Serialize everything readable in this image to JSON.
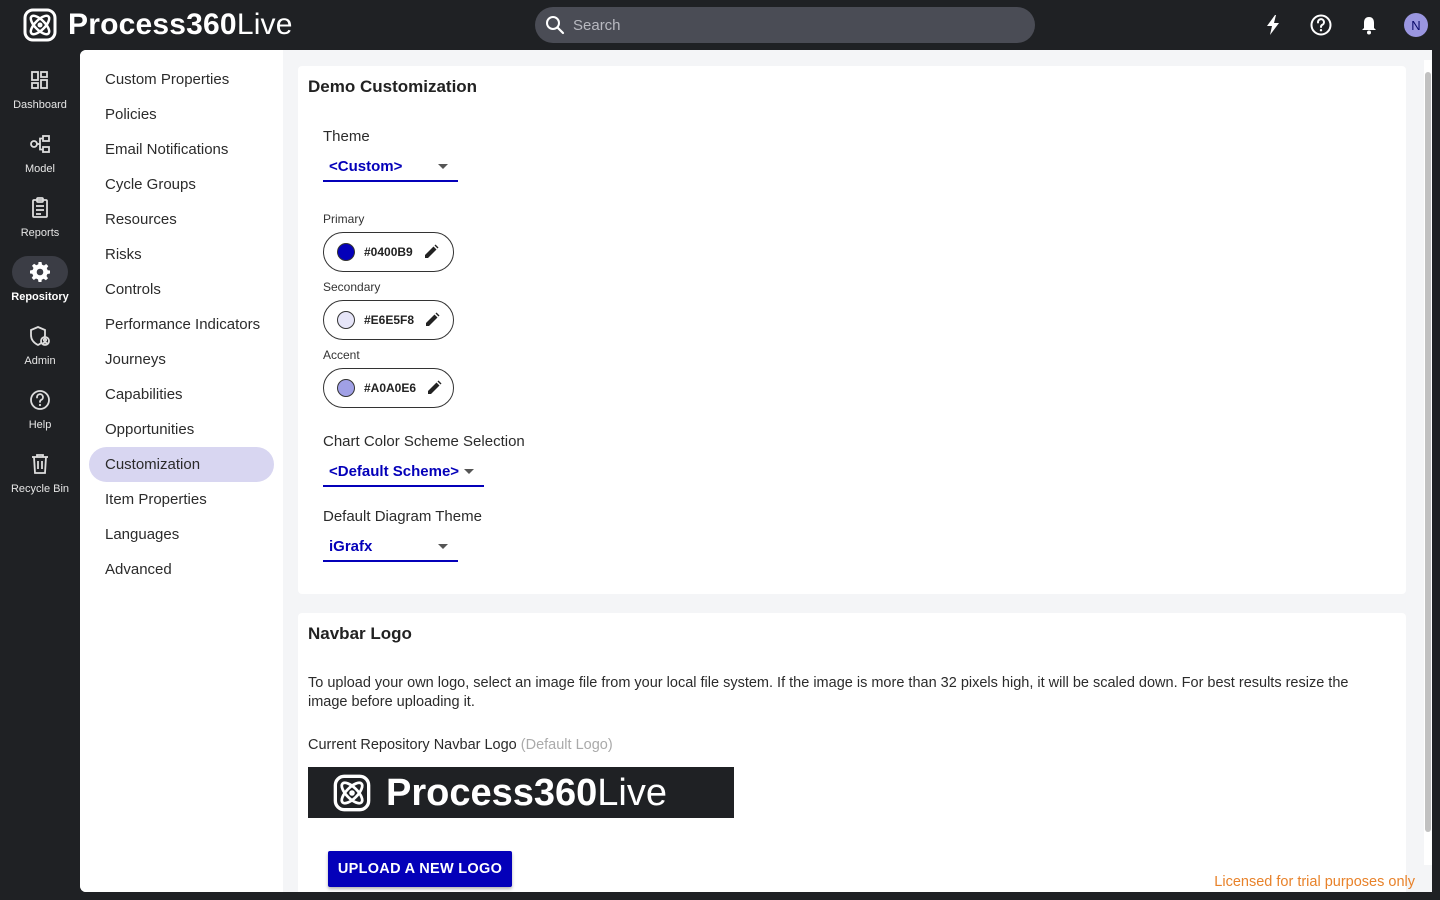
{
  "app": {
    "brand_bold": "Process360",
    "brand_light": "Live",
    "search_placeholder": "Search",
    "avatar_initial": "N"
  },
  "rail": [
    {
      "label": "Dashboard",
      "icon": "dashboard-icon"
    },
    {
      "label": "Model",
      "icon": "model-icon"
    },
    {
      "label": "Reports",
      "icon": "reports-icon"
    },
    {
      "label": "Repository",
      "icon": "gear-icon",
      "active": true
    },
    {
      "label": "Admin",
      "icon": "admin-shield-icon"
    },
    {
      "label": "Help",
      "icon": "help-icon"
    },
    {
      "label": "Recycle Bin",
      "icon": "trash-icon"
    }
  ],
  "subnav": [
    "Custom Properties",
    "Policies",
    "Email Notifications",
    "Cycle Groups",
    "Resources",
    "Risks",
    "Controls",
    "Performance Indicators",
    "Journeys",
    "Capabilities",
    "Opportunities",
    "Customization",
    "Item Properties",
    "Languages",
    "Advanced"
  ],
  "demo": {
    "title": "Demo Customization",
    "theme_label": "Theme",
    "theme_value": "<Custom>",
    "primary_label": "Primary",
    "primary_hex": "#0400B9",
    "secondary_label": "Secondary",
    "secondary_hex": "#E6E5F8",
    "accent_label": "Accent",
    "accent_hex": "#A0A0E6",
    "chart_label": "Chart Color Scheme Selection",
    "chart_value": "<Default Scheme>",
    "diagram_label": "Default Diagram Theme",
    "diagram_value": "iGrafx"
  },
  "navbar_logo": {
    "title": "Navbar Logo",
    "description": "To upload your own logo, select an image file from your local file system. If the image is more than 32 pixels high, it will be scaled down. For best results resize the image before uploading it.",
    "current_label": "Current Repository Navbar Logo",
    "current_note": "(Default Logo)",
    "logo_bold": "Process360",
    "logo_light": "Live",
    "upload_button": "UPLOAD A NEW LOGO"
  },
  "license_text": "Licensed for trial purposes only",
  "colors": {
    "primary": "#0400B9",
    "secondary": "#E6E5F8",
    "accent": "#A0A0E6",
    "license": "#e8822a"
  }
}
